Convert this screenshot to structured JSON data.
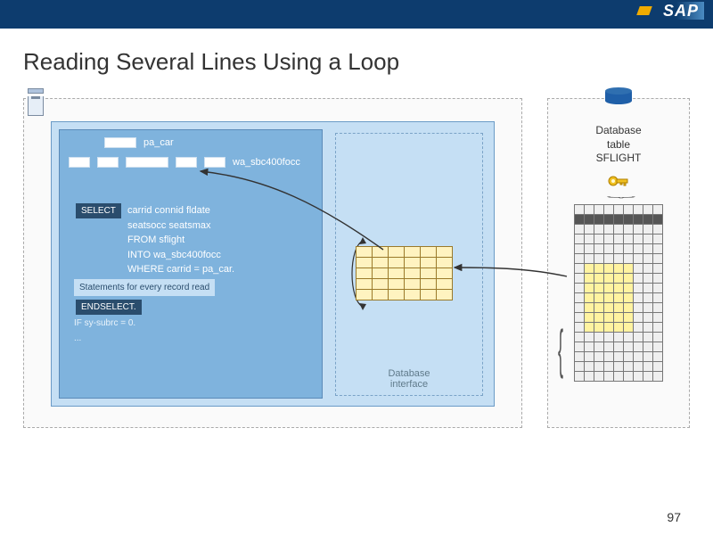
{
  "header": {
    "logo": "SAP"
  },
  "title": "Reading Several Lines Using a Loop",
  "code": {
    "param_var": "pa_car",
    "workarea_var": "wa_sbc400focc",
    "select_kw": "SELECT",
    "select_body_l1": "carrid connid fldate",
    "select_body_l2": "seatsocc seatsmax",
    "select_body_l3": "FROM sflight",
    "select_body_l4": "INTO wa_sbc400focc",
    "select_body_l5": "WHERE carrid = pa_car.",
    "stmt_comment": "Statements for every record read",
    "endselect_kw": "ENDSELECT.",
    "if_line": "IF sy-subrc = 0.",
    "ellipsis": "..."
  },
  "diagram": {
    "db_interface_label": "Database\ninterface",
    "db_table_label_l1": "Database",
    "db_table_label_l2": "table",
    "db_table_label_l3": "SFLIGHT"
  },
  "page_number": "97"
}
